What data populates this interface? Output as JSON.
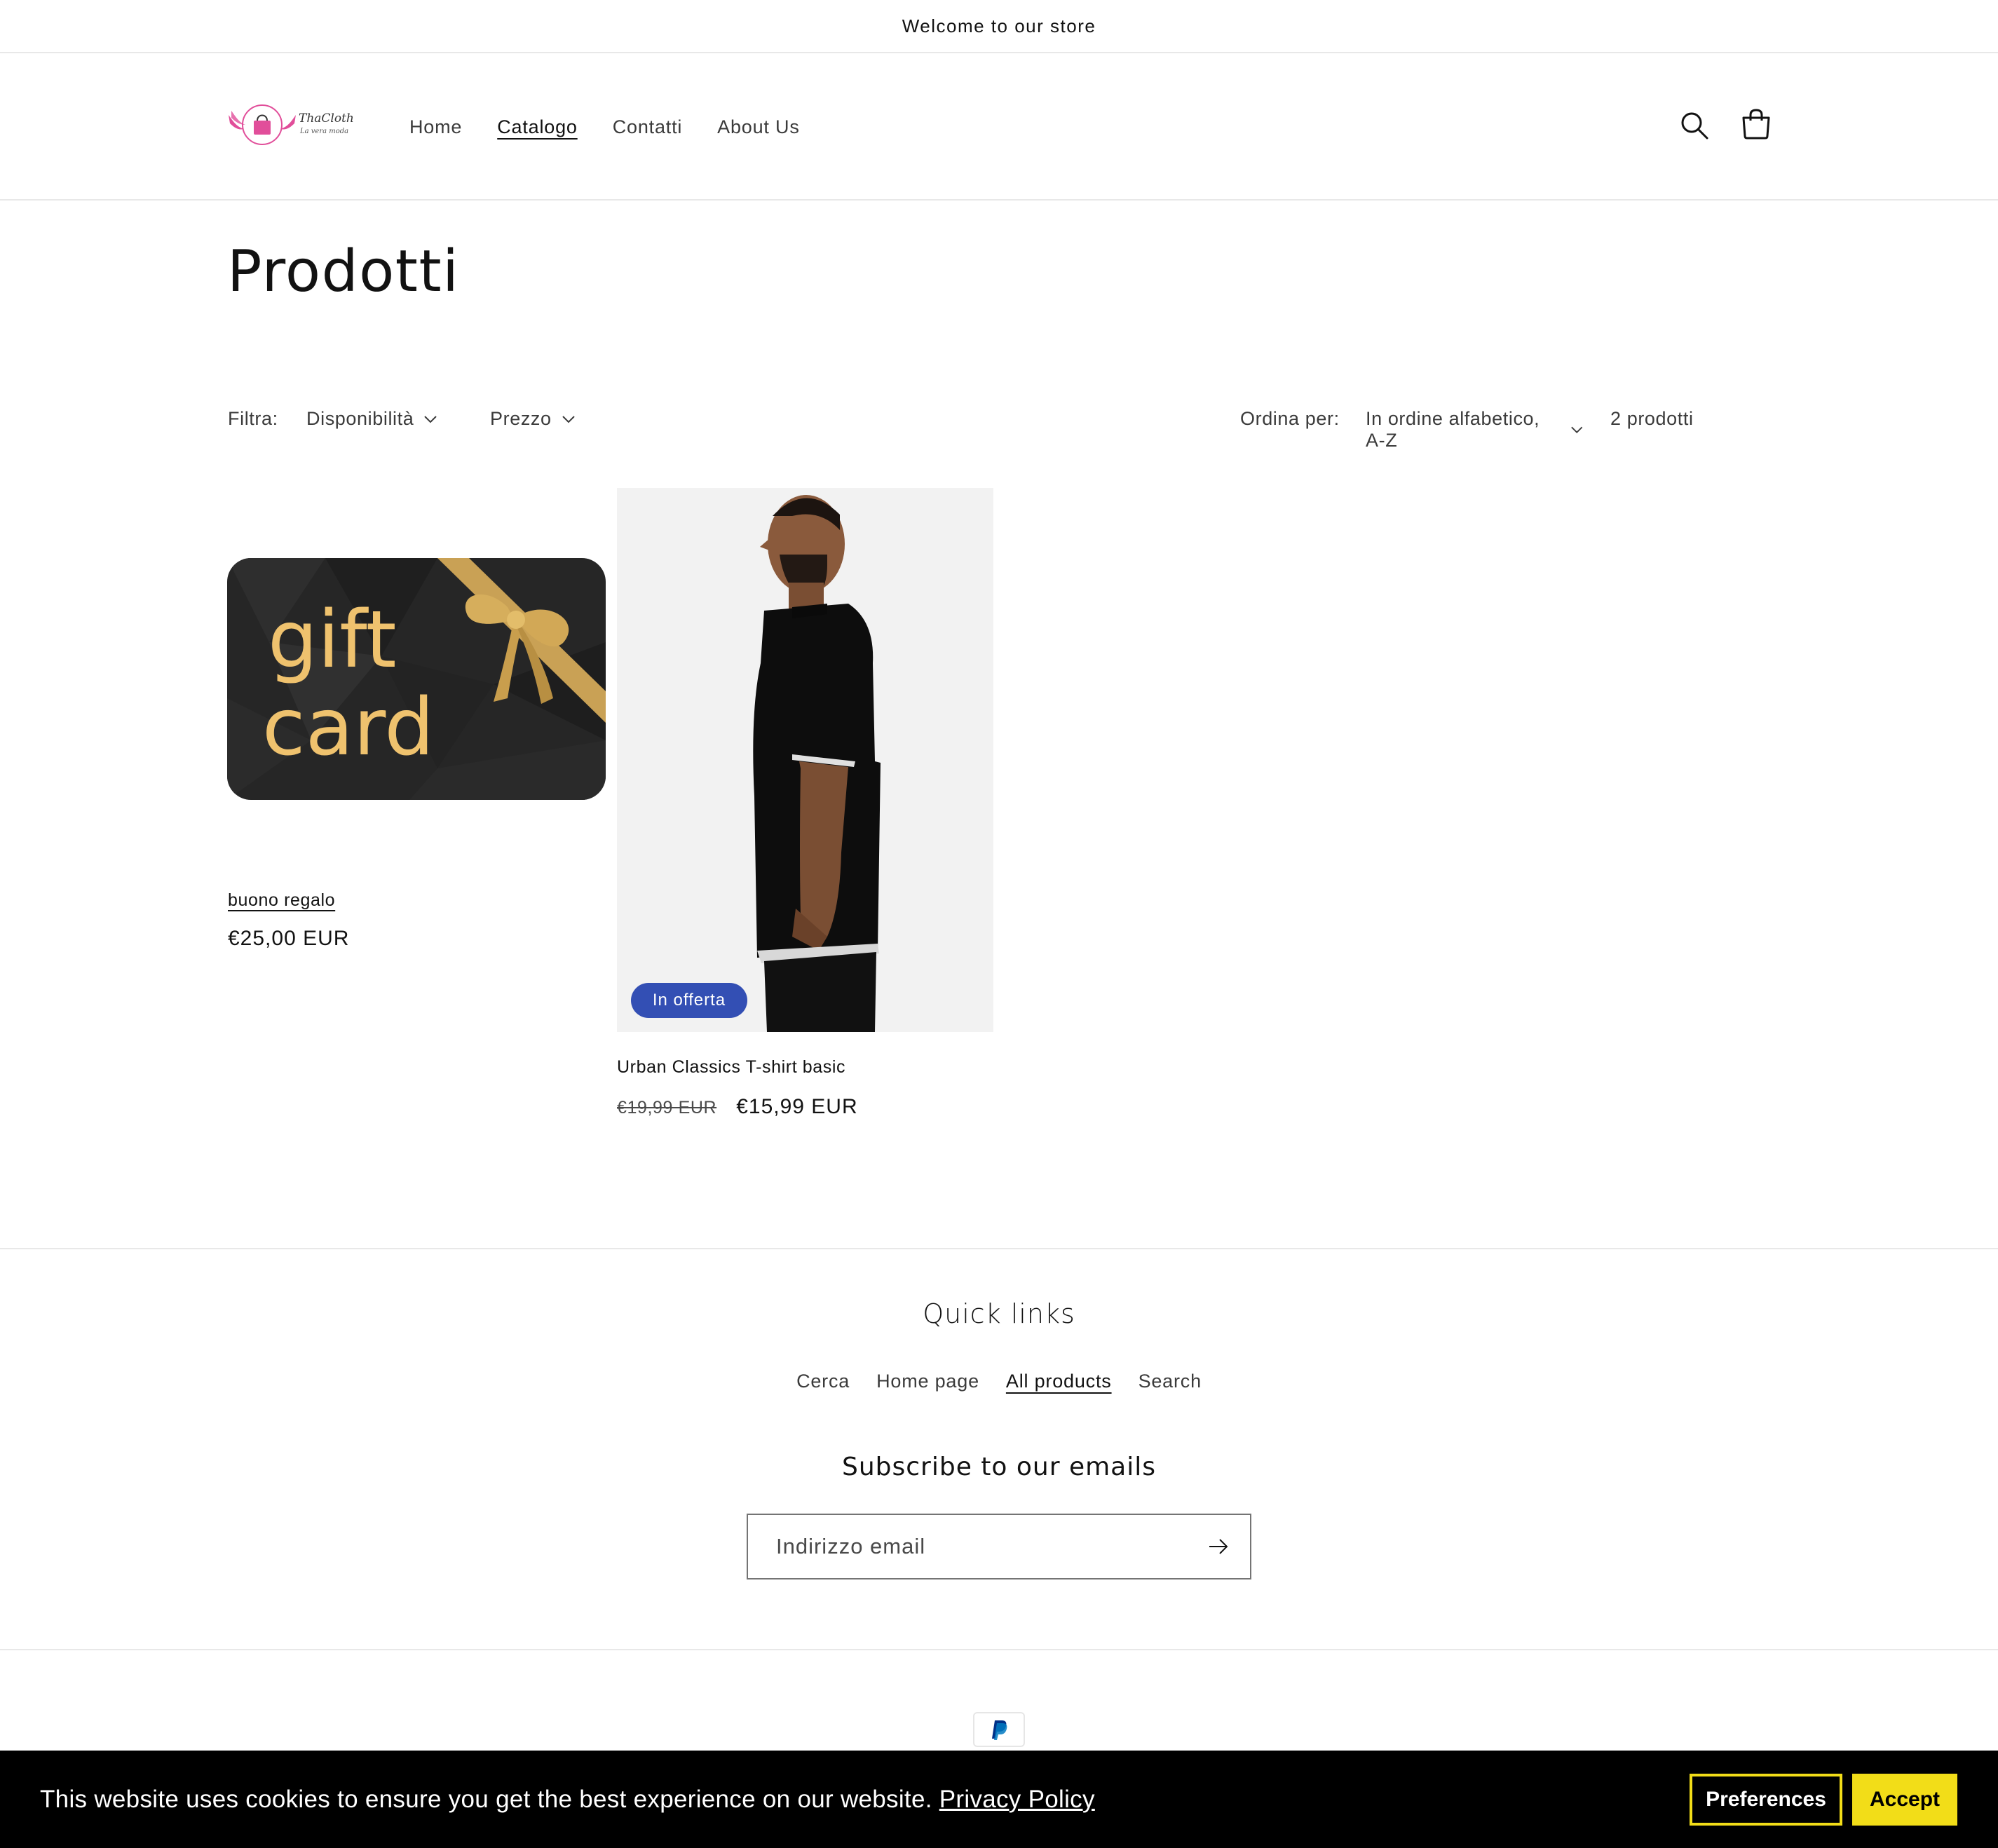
{
  "announcement": "Welcome to our store",
  "header": {
    "logo_text": "ThaClothes",
    "logo_tagline": "La vera moda",
    "nav": [
      {
        "label": "Home"
      },
      {
        "label": "Catalogo"
      },
      {
        "label": "Contatti"
      },
      {
        "label": "About Us"
      }
    ],
    "search_icon": "search-icon",
    "cart_icon": "cart-icon"
  },
  "page_title": "Prodotti",
  "filters": {
    "label": "Filtra:",
    "availability": "Disponibilità",
    "price": "Prezzo",
    "sort_label": "Ordina per:",
    "sort_value": "In ordine alfabetico, A-Z",
    "count": "2 prodotti"
  },
  "products": [
    {
      "image_text_line1": "gift",
      "image_text_line2": "card",
      "title": "buono regalo",
      "price": "€25,00 EUR"
    },
    {
      "badge": "In offerta",
      "title": "Urban Classics T-shirt basic",
      "old_price": "€19,99 EUR",
      "price": "€15,99 EUR"
    }
  ],
  "footer": {
    "quick_links_title": "Quick links",
    "quick_links": [
      "Cerca",
      "Home page",
      "All products",
      "Search"
    ],
    "subscribe_title": "Subscribe to our emails",
    "email_placeholder": "Indirizzo email",
    "payment_icon": "paypal-icon"
  },
  "cookie": {
    "text": "This website uses cookies to ensure you get the best experience on our website.",
    "link": "Privacy Policy",
    "preferences": "Preferences",
    "accept": "Accept"
  },
  "colors": {
    "badge": "#334fb4",
    "cookie_bg": "#000000",
    "cookie_button": "#f2dd18",
    "logo_pink": "#e14e9a"
  }
}
